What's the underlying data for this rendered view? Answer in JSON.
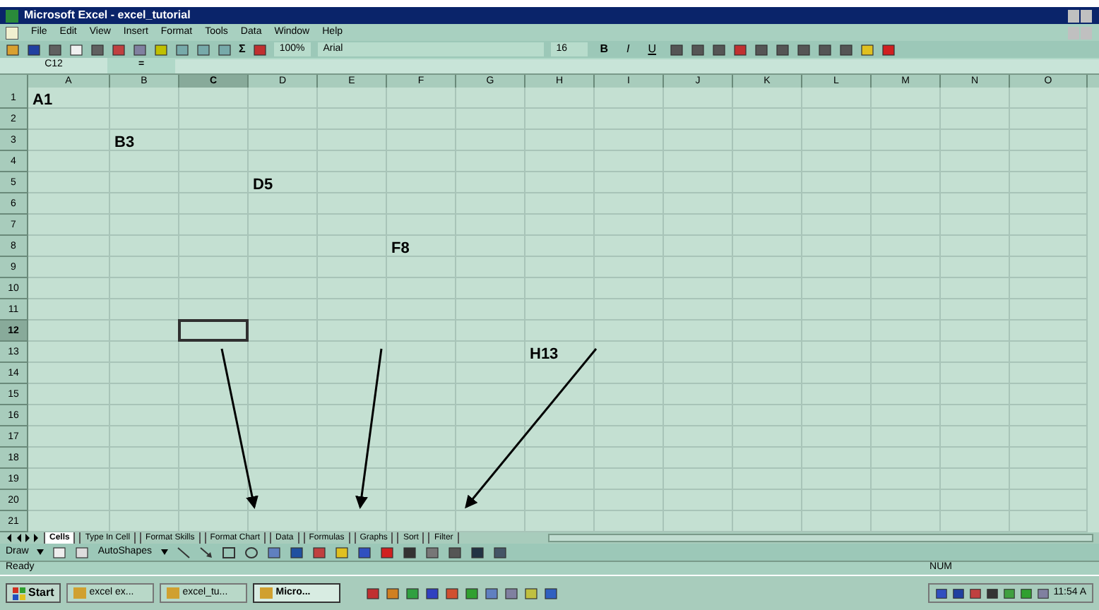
{
  "window": {
    "title": "Microsoft Excel - excel_tutorial"
  },
  "menu": [
    "File",
    "Edit",
    "View",
    "Insert",
    "Format",
    "Tools",
    "Data",
    "Window",
    "Help"
  ],
  "toolbar": {
    "sum": "Σ",
    "zoom": "100%",
    "font": "Arial",
    "font_size": "16",
    "bold": "B",
    "italic": "I",
    "underline": "U"
  },
  "formula_bar": {
    "name_box": "C12",
    "equals": "="
  },
  "columns": [
    {
      "label": "A",
      "selected": false
    },
    {
      "label": "B",
      "selected": false
    },
    {
      "label": "C",
      "selected": true
    },
    {
      "label": "D",
      "selected": false
    },
    {
      "label": "E",
      "selected": false
    },
    {
      "label": "F",
      "selected": false
    },
    {
      "label": "G",
      "selected": false
    },
    {
      "label": "H",
      "selected": false
    },
    {
      "label": "I",
      "selected": false
    },
    {
      "label": "J",
      "selected": false
    },
    {
      "label": "K",
      "selected": false
    },
    {
      "label": "L",
      "selected": false
    },
    {
      "label": "M",
      "selected": false
    },
    {
      "label": "N",
      "selected": false
    },
    {
      "label": "O",
      "selected": false
    }
  ],
  "rows": [
    {
      "label": "1",
      "selected": false,
      "cells": [
        {
          "text": "A1"
        }
      ]
    },
    {
      "label": "2",
      "selected": false
    },
    {
      "label": "3",
      "selected": false,
      "cells": [
        {},
        {
          "text": "B3"
        }
      ]
    },
    {
      "label": "4",
      "selected": false
    },
    {
      "label": "5",
      "selected": false,
      "cells": [
        {},
        {},
        {},
        {
          "text": "D5"
        }
      ]
    },
    {
      "label": "6",
      "selected": false
    },
    {
      "label": "7",
      "selected": false
    },
    {
      "label": "8",
      "selected": false,
      "cells": [
        {},
        {},
        {},
        {},
        {},
        {
          "text": "F8"
        }
      ]
    },
    {
      "label": "9",
      "selected": false
    },
    {
      "label": "10",
      "selected": false
    },
    {
      "label": "11",
      "selected": false
    },
    {
      "label": "12",
      "selected": true
    },
    {
      "label": "13",
      "selected": false,
      "cells": [
        {},
        {},
        {},
        {},
        {},
        {},
        {},
        {
          "text": "H13"
        }
      ]
    },
    {
      "label": "14",
      "selected": false
    },
    {
      "label": "15",
      "selected": false
    },
    {
      "label": "16",
      "selected": false
    },
    {
      "label": "17",
      "selected": false
    },
    {
      "label": "18",
      "selected": false
    },
    {
      "label": "19",
      "selected": false
    },
    {
      "label": "20",
      "selected": false
    },
    {
      "label": "21",
      "selected": false
    }
  ],
  "sheet_tabs": [
    {
      "label": "Cells",
      "selected": true
    },
    {
      "label": "Type In Cell",
      "selected": false
    },
    {
      "label": "Format Skills",
      "selected": false
    },
    {
      "label": "Format Chart",
      "selected": false
    },
    {
      "label": "Data",
      "selected": false
    },
    {
      "label": "Formulas",
      "selected": false
    },
    {
      "label": "Graphs",
      "selected": false
    },
    {
      "label": "Sort",
      "selected": false
    },
    {
      "label": "Filter",
      "selected": false
    }
  ],
  "drawing_toolbar": {
    "draw": "Draw",
    "autoshapes": "AutoShapes"
  },
  "status_bar": {
    "status": "Ready",
    "num": "NUM"
  },
  "taskbar": {
    "start": "Start",
    "tasks": [
      {
        "label": "excel ex...",
        "selected": false
      },
      {
        "label": "excel_tu...",
        "selected": false
      },
      {
        "label": "Micro...",
        "selected": true
      }
    ],
    "clock": "11:54 A"
  }
}
